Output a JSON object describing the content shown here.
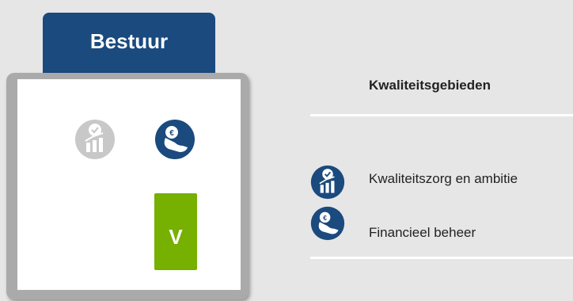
{
  "tab": {
    "label": "Bestuur"
  },
  "card": {
    "score_label": "V",
    "colors": {
      "tab": "#1a4a7e",
      "score_good": "#76b000",
      "icon_inactive": "#c8c8c8",
      "icon_active": "#1a4a7e"
    },
    "icons": [
      "quality-ambition-icon-inactive",
      "financial-management-icon-active"
    ]
  },
  "legend": {
    "title": "Kwaliteitsgebieden",
    "items": [
      {
        "icon": "quality-ambition-icon",
        "label": "Kwaliteitszorg en ambitie"
      },
      {
        "icon": "financial-management-icon",
        "label": "Financieel beheer"
      }
    ]
  }
}
